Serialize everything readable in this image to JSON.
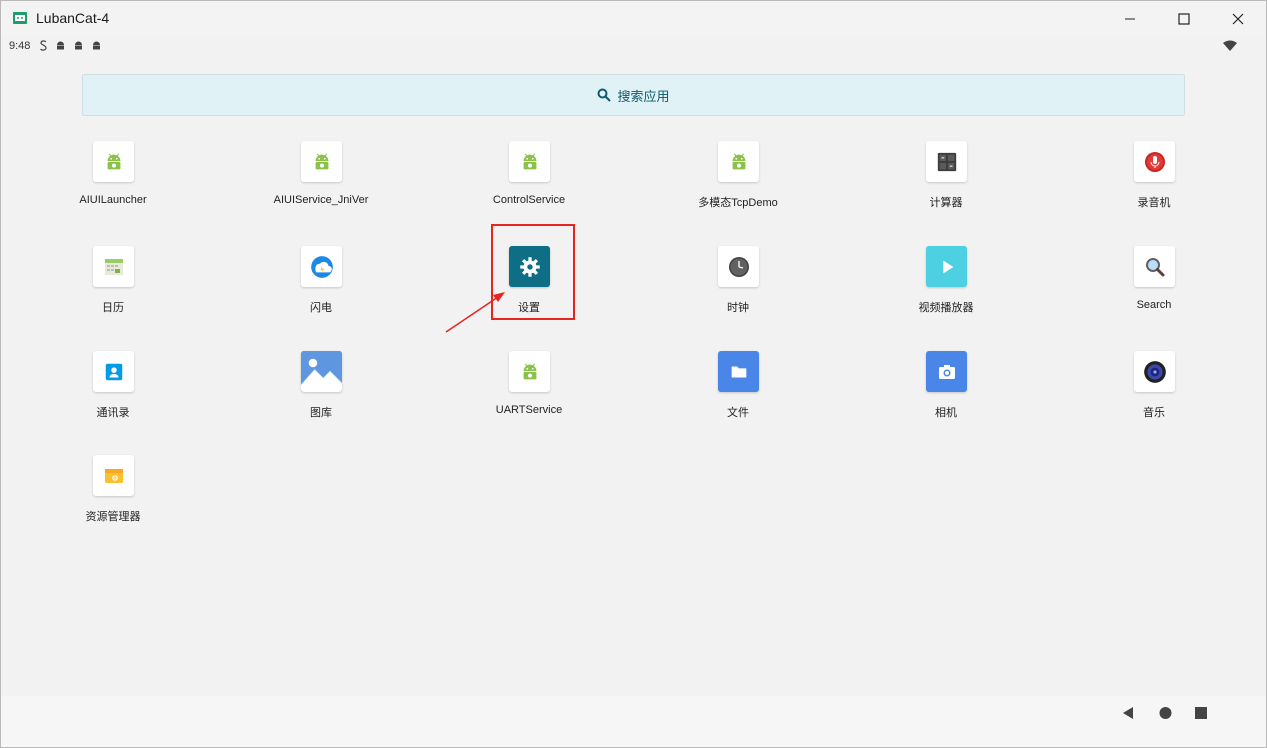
{
  "window": {
    "title": "LubanCat-4"
  },
  "status": {
    "time": "9:48"
  },
  "search": {
    "label": "搜索应用"
  },
  "apps": [
    {
      "label": "AIUILauncher",
      "icon": "android-icon"
    },
    {
      "label": "AIUIService_JniVer",
      "icon": "android-icon"
    },
    {
      "label": "ControlService",
      "icon": "android-icon"
    },
    {
      "label": "多模态TcpDemo",
      "icon": "android-icon"
    },
    {
      "label": "计算器",
      "icon": "calculator-icon"
    },
    {
      "label": "录音机",
      "icon": "microphone-icon"
    },
    {
      "label": "日历",
      "icon": "calendar-icon"
    },
    {
      "label": "闪电",
      "icon": "lightning-icon"
    },
    {
      "label": "设置",
      "icon": "gear-icon"
    },
    {
      "label": "时钟",
      "icon": "clock-icon"
    },
    {
      "label": "视频播放器",
      "icon": "play-icon"
    },
    {
      "label": "Search",
      "icon": "search-icon"
    },
    {
      "label": "通讯录",
      "icon": "contacts-icon"
    },
    {
      "label": "图库",
      "icon": "gallery-icon"
    },
    {
      "label": "UARTService",
      "icon": "android-icon"
    },
    {
      "label": "文件",
      "icon": "folder-icon"
    },
    {
      "label": "相机",
      "icon": "camera-icon"
    },
    {
      "label": "音乐",
      "icon": "music-icon"
    },
    {
      "label": "资源管理器",
      "icon": "file-manager-icon"
    }
  ],
  "colors": {
    "accent_teal": "#0d6e85",
    "highlight_red": "#e8241e",
    "android_green": "#8bc34a"
  }
}
